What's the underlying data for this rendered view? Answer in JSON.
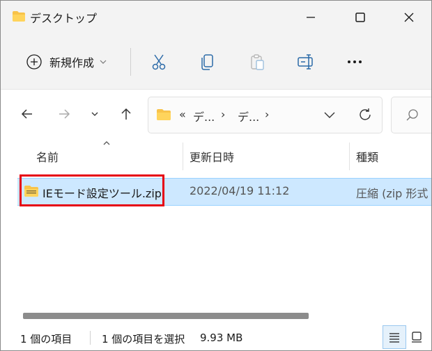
{
  "window": {
    "title": "デスクトップ"
  },
  "toolbar": {
    "new_label": "新規作成",
    "icons": [
      "cut-icon",
      "copy-icon",
      "paste-icon",
      "rename-icon",
      "more-icon"
    ]
  },
  "address": {
    "overflow": "«",
    "crumbs": [
      "デ...",
      "デ..."
    ],
    "separator": "›"
  },
  "columns": {
    "name": "名前",
    "date": "更新日時",
    "type": "種類"
  },
  "files": [
    {
      "name": "IEモード設定ツール.zip",
      "modified": "2022/04/19 11:12",
      "type": "圧縮 (zip 形式"
    }
  ],
  "status": {
    "item_count": "1 個の項目",
    "selected": "1 個の項目を選択",
    "size": "9.93 MB"
  },
  "colors": {
    "selection": "#cde8ff",
    "highlight": "#e60012",
    "folder": "#f8c34a"
  }
}
